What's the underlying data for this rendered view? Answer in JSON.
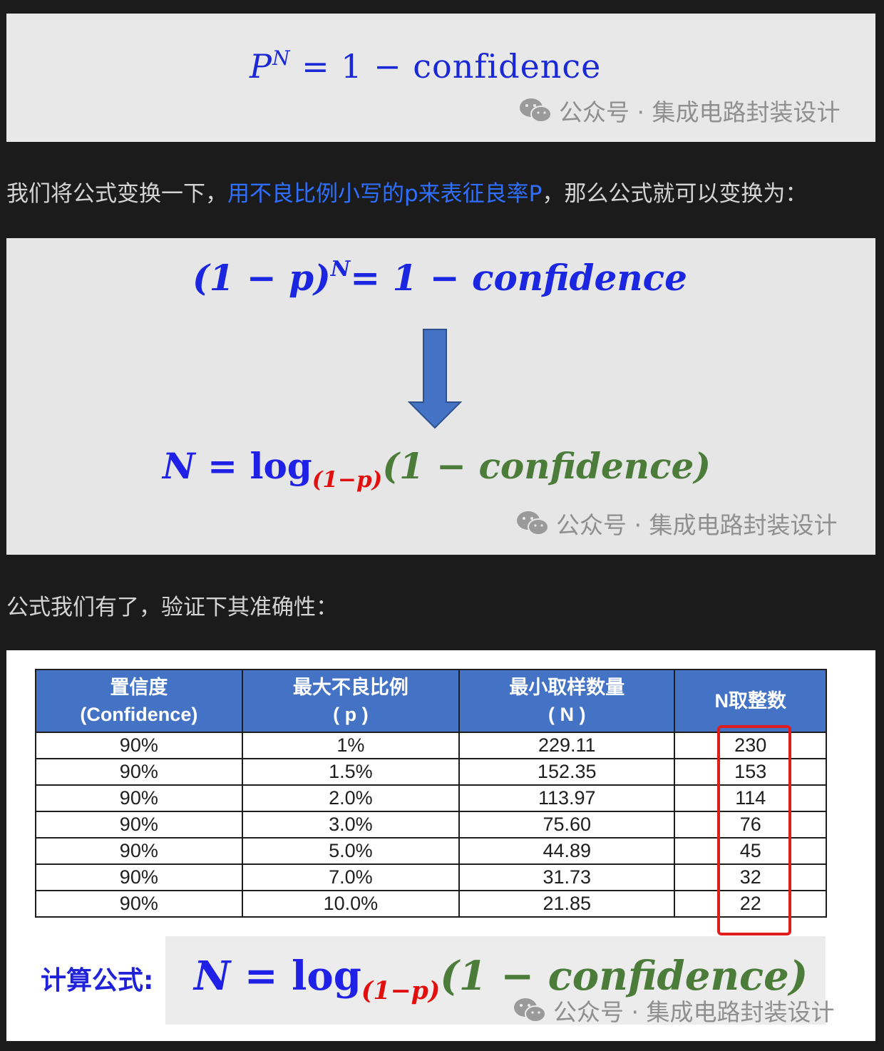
{
  "formula1": {
    "lhs": "P",
    "exp": "N",
    "rhs": "= 1 − confidence"
  },
  "watermark": {
    "text": "公众号 · 集成电路封装设计"
  },
  "para1": {
    "before": "我们将公式变换一下，",
    "highlight": "用不良比例小写的p来表征良率P",
    "after": "，那么公式就可以变换为："
  },
  "formula2": {
    "lhs": "(1 − p)",
    "exp": "N",
    "rhs": "= 1 − confidence"
  },
  "formula3": {
    "n": "N",
    "eq": "=",
    "log": "log",
    "base": "(1−p)",
    "arg": "(1 − confidence)"
  },
  "para2": {
    "text": "公式我们有了，验证下其准确性："
  },
  "table": {
    "headers": [
      [
        "置信度",
        "(Confidence)"
      ],
      [
        "最大不良比例",
        "( p )"
      ],
      [
        "最小取样数量",
        "( N )"
      ],
      [
        "N取整数"
      ]
    ],
    "rows": [
      [
        "90%",
        "1%",
        "229.11",
        "230"
      ],
      [
        "90%",
        "1.5%",
        "152.35",
        "153"
      ],
      [
        "90%",
        "2.0%",
        "113.97",
        "114"
      ],
      [
        "90%",
        "3.0%",
        "75.60",
        "76"
      ],
      [
        "90%",
        "5.0%",
        "44.89",
        "45"
      ],
      [
        "90%",
        "7.0%",
        "31.73",
        "32"
      ],
      [
        "90%",
        "10.0%",
        "21.85",
        "22"
      ]
    ]
  },
  "calc": {
    "label": "计算公式:"
  },
  "icons": {
    "watermark": "wechat-icon",
    "arrow": "down-arrow-icon"
  },
  "colors": {
    "formula_blue": "#1f22e6",
    "base_red": "#e20f0f",
    "arg_green": "#4b7c3a",
    "header_blue": "#4472c4",
    "highlight_box": "#e01c1c"
  }
}
